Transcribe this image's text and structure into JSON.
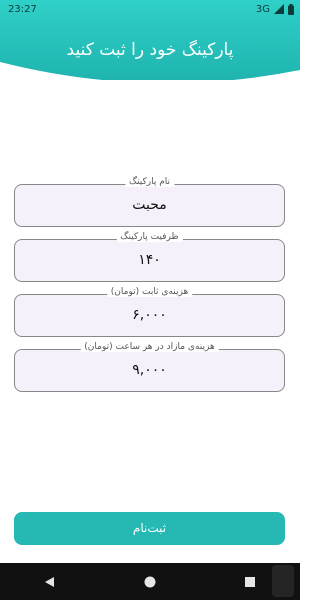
{
  "status_bar": {
    "time": "23:27",
    "network": "3G"
  },
  "header": {
    "title": "پارکینگ خود را ثبت کنید",
    "color": "#26b9b4"
  },
  "fields": [
    {
      "label": "نام پارکینگ",
      "value": "محبت"
    },
    {
      "label": "ظرفیت پارکینگ",
      "value": "۱۴۰"
    },
    {
      "label": "هزینه‌ی ثابت (تومان)",
      "value": "۶,۰۰۰"
    },
    {
      "label": "هزینه‌ی مازاد در هر ساعت (تومان)",
      "value": "۹,۰۰۰"
    }
  ],
  "submit": {
    "label": "ثبت‌نام",
    "color": "#26b9b4"
  },
  "nav": {
    "icons": [
      "back-icon",
      "home-icon",
      "recents-icon"
    ]
  }
}
